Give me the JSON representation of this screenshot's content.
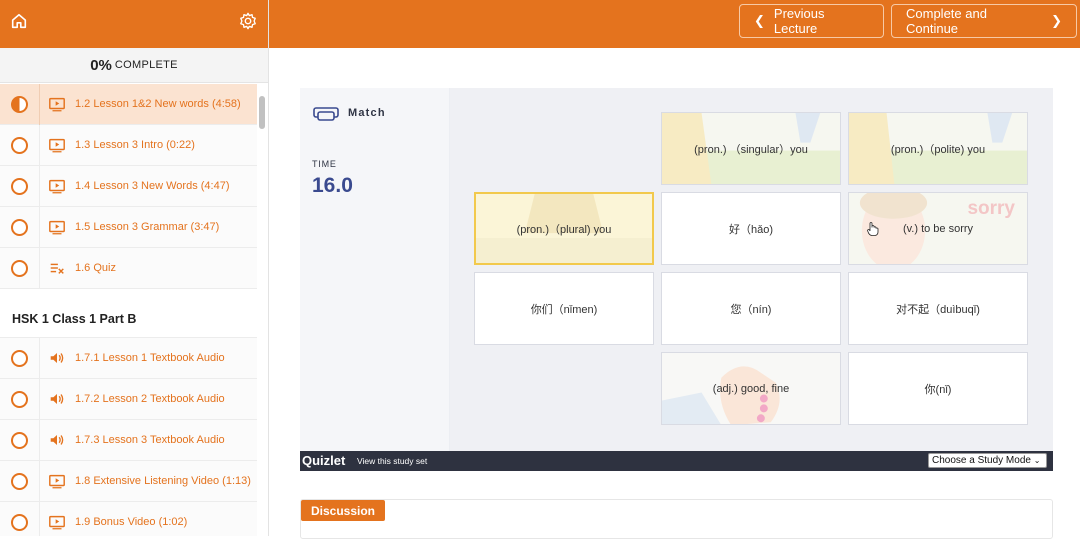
{
  "progress": {
    "percent": "0%",
    "label": "COMPLETE"
  },
  "lectures_a": [
    {
      "title": "1.2 Lesson 1&2 New words (4:58)",
      "status": "half",
      "type": "video"
    },
    {
      "title": "1.3 Lesson 3 Intro (0:22)",
      "status": "empty",
      "type": "video"
    },
    {
      "title": "1.4 Lesson 3 New Words (4:47)",
      "status": "empty",
      "type": "video"
    },
    {
      "title": "1.5 Lesson 3 Grammar (3:47)",
      "status": "empty",
      "type": "video"
    },
    {
      "title": "1.6 Quiz",
      "status": "empty",
      "type": "quiz"
    }
  ],
  "section_b": {
    "title": "HSK 1 Class 1 Part B"
  },
  "lectures_b": [
    {
      "title": "1.7.1 Lesson 1 Textbook Audio",
      "status": "empty",
      "type": "audio"
    },
    {
      "title": "1.7.2 Lesson 2 Textbook Audio",
      "status": "empty",
      "type": "audio"
    },
    {
      "title": "1.7.3 Lesson 3 Textbook Audio",
      "status": "empty",
      "type": "audio"
    },
    {
      "title": "1.8 Extensive Listening Video (1:13)",
      "status": "empty",
      "type": "video"
    },
    {
      "title": "1.9 Bonus Video (1:02)",
      "status": "empty",
      "type": "video"
    }
  ],
  "topbar": {
    "prev_label": "Previous Lecture",
    "next_label": "Complete and Continue"
  },
  "quizlet": {
    "mode_label": "Match",
    "time_label": "TIME",
    "time_value": "16.0",
    "cards": {
      "c1": "(pron.) （singular）you",
      "c2": "(pron.)（polite) you",
      "c3": "(pron.)（plural) you",
      "c4": "好（hǎo)",
      "c5": "(v.) to be sorry",
      "c6": "你们（nǐmen)",
      "c7": "您（nín)",
      "c8": "对不起（duìbuqǐ)",
      "c9": "(adj.) good, fine",
      "c10": "你(nǐ)"
    },
    "sorry_word": "sorry",
    "logo": "Quizlet",
    "view_link": "View this study set",
    "study_mode": "Choose a Study Mode"
  },
  "discussion": {
    "label": "Discussion"
  },
  "colors": {
    "brand": "#e4731e",
    "selected_card": "#f2c94c",
    "time": "#3a4a8f"
  },
  "icons": {
    "home": "home-icon",
    "settings": "gear-icon",
    "video": "play-video-icon",
    "audio": "speaker-icon",
    "quiz": "quiz-checklist-icon"
  }
}
